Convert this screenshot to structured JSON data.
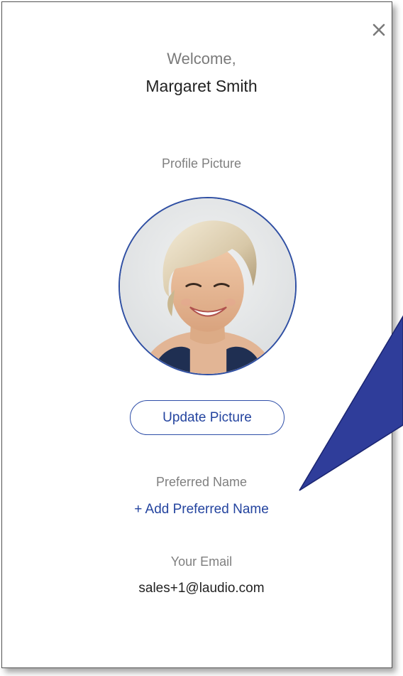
{
  "dialog": {
    "close_label": "×",
    "welcome": "Welcome,",
    "user_name": "Margaret Smith"
  },
  "profile": {
    "label": "Profile Picture",
    "update_button": "Update Picture"
  },
  "preferred_name": {
    "label": "Preferred Name",
    "add_link": "+ Add Preferred Name"
  },
  "email": {
    "label": "Your Email",
    "value": "sales+1@laudio.com"
  },
  "colors": {
    "accent": "#24449f",
    "callout": "#2f3d9a",
    "muted_text": "#7f7f7f",
    "primary_text": "#222222"
  },
  "icons": {
    "close": "close-icon",
    "avatar": "profile-photo"
  }
}
